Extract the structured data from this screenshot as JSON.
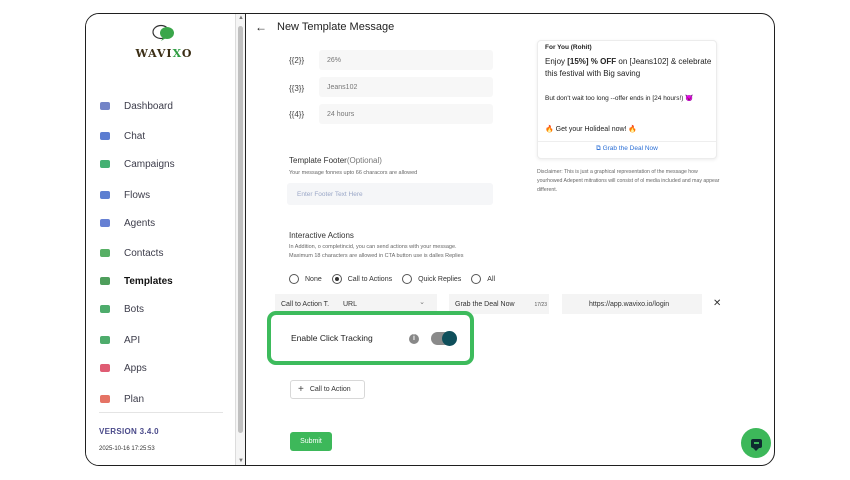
{
  "app": {
    "logo": "WAVIXO",
    "version": "VERSION 3.4.0",
    "build_date": "2025-10-16 17:25:53"
  },
  "sidebar": {
    "items": [
      {
        "label": "Dashboard",
        "icon": "monitor-icon",
        "color": "#5a6fbd"
      },
      {
        "label": "Chat",
        "icon": "chat-icon",
        "color": "#3f66c9"
      },
      {
        "label": "Campaigns",
        "icon": "send-icon",
        "color": "#23a35a"
      },
      {
        "label": "Flows",
        "icon": "flow-icon",
        "color": "#4169c9"
      },
      {
        "label": "Agents",
        "icon": "user-icon",
        "color": "#4b6acb"
      },
      {
        "label": "Contacts",
        "icon": "contacts-icon",
        "color": "#3aa14a"
      },
      {
        "label": "Templates",
        "icon": "templates-icon",
        "color": "#2f8d3f"
      },
      {
        "label": "Bots",
        "icon": "share-icon",
        "color": "#2f9d52"
      },
      {
        "label": "API",
        "icon": "globe-icon",
        "color": "#2f9d52"
      },
      {
        "label": "Apps",
        "icon": "apps-icon",
        "color": "#d9405a"
      },
      {
        "label": "Plan",
        "icon": "card-icon",
        "color": "#e05a4a"
      }
    ]
  },
  "header": {
    "title": "New Template Message"
  },
  "variables": [
    {
      "label": "{{2}}",
      "value": "26%"
    },
    {
      "label": "{{3}}",
      "value": "Jeans102"
    },
    {
      "label": "{{4}}",
      "value": "24 hours"
    }
  ],
  "footer": {
    "title": "Template Footer",
    "optional": "(Optional)",
    "hint": "Your message fonnes upto 66 characors are allowed",
    "placeholder": "Enter Footer Text Here"
  },
  "actions": {
    "title": "Interactive Actions",
    "hint1": "In Addition, o completincid, you can send actions with your message.",
    "hint2": "Maximum 18 characters are allowed in CTA button use is dalles Replies",
    "options": [
      "None",
      "Call to Actions",
      "Quick Replies",
      "All"
    ],
    "selected": "Call to Actions",
    "cta": {
      "type_label": "Call to Action T.",
      "type_value": "URL",
      "button_text": "Grab the Deal Now",
      "char_count": "17/23",
      "url": "https://app.wavixo.io/login"
    },
    "tracking_label": "Enable Click Tracking",
    "tracking_on": true,
    "add_button": "Call to Action",
    "submit": "Submit"
  },
  "preview": {
    "from": "For You  (Rohit)",
    "line1_a": "Enjoy ",
    "line1_b": "[15%] % OFF",
    "line1_c": " on [Jeans102] & celebrate this festival with Big saving",
    "line2": "But don't wait too long --offer ends in [24 hours!) 😈",
    "line3": "🔥  Get your Holideal now!  🔥",
    "deal": "Grab the Deal Now",
    "disclaimer": "Disclaimer: This is just a graphical representation of the message how yourhowed Adepent mitrations will consist of ol media included and may appear different."
  },
  "colors": {
    "accent": "#3db85a",
    "toggle_knob": "#0f4f5b",
    "link": "#2b6fd6"
  }
}
